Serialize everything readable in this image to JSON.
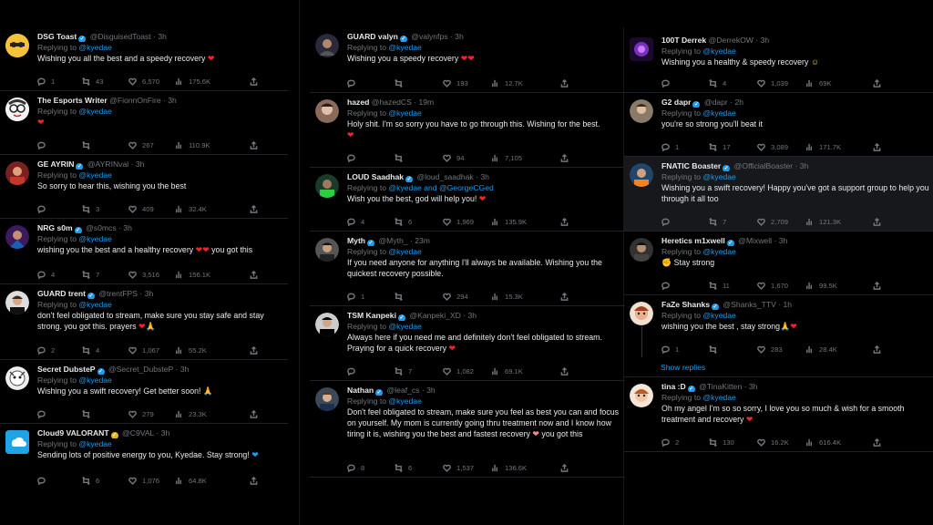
{
  "colors": {
    "background": "#000000",
    "text": "#e7e9ea",
    "muted": "#71767b",
    "link": "#1d9bf0",
    "heart": "#f4212e"
  },
  "columns": [
    {
      "tweets": [
        {
          "name": "DSG Toast",
          "handle": "@DisguisedToast",
          "time": "3h",
          "reply_to": "@kyedae",
          "text": "Wishing you all the best and a speedy recovery",
          "replies": "1",
          "retweets": "43",
          "likes": "6,570",
          "views": "175.6K"
        },
        {
          "name": "The Esports Writer",
          "handle": "@FionnOnFire",
          "time": "3h",
          "reply_to": "@kyedae",
          "text": "",
          "replies": "",
          "retweets": "",
          "likes": "267",
          "views": "110.9K"
        },
        {
          "name": "GE AYRIN",
          "handle": "@AYRINval",
          "time": "3h",
          "reply_to": "@kyedae",
          "text": "So sorry to hear this, wishing you the best",
          "replies": "",
          "retweets": "3",
          "likes": "409",
          "views": "32.4K"
        },
        {
          "name": "NRG s0m",
          "handle": "@s0mcs",
          "time": "3h",
          "reply_to": "@kyedae",
          "text": "wishing you the best and a healthy recovery",
          "text2": "you got this",
          "replies": "4",
          "retweets": "7",
          "likes": "3,516",
          "views": "156.1K"
        },
        {
          "name": "GUARD trent",
          "handle": "@trentFPS",
          "time": "3h",
          "reply_to": "@kyedae",
          "text": "don't feel obligated to stream, make sure you stay safe and stay strong. you got this. prayers",
          "replies": "2",
          "retweets": "4",
          "likes": "1,067",
          "views": "55.2K"
        },
        {
          "name": "Secret DubsteP",
          "handle": "@Secret_DubsteP",
          "time": "3h",
          "reply_to": "@kyedae",
          "text": "Wishing you a swift recovery! Get better soon!",
          "replies": "",
          "retweets": "",
          "likes": "279",
          "views": "23.3K"
        },
        {
          "name": "Cloud9 VALORANT",
          "handle": "@C9VAL",
          "time": "3h",
          "reply_to": "@kyedae",
          "text": "Sending lots of positive energy to you, Kyedae. Stay strong!",
          "replies": "",
          "retweets": "6",
          "likes": "1,076",
          "views": "64.8K"
        }
      ]
    },
    {
      "tweets": [
        {
          "name": "GUARD valyn",
          "handle": "@valynfps",
          "time": "3h",
          "reply_to": "@kyedae",
          "text": "Wishing you a speedy recovery",
          "replies": "",
          "retweets": "",
          "likes": "193",
          "views": "12.7K"
        },
        {
          "name": "hazed",
          "handle": "@hazedCS",
          "time": "19m",
          "reply_to": "@kyedae",
          "text": "Holy shit. I'm so sorry you have to go through this. Wishing for the best.",
          "replies": "",
          "retweets": "",
          "likes": "94",
          "views": "7,105"
        },
        {
          "name": "LOUD Saadhak",
          "handle": "@loud_saadhak",
          "time": "3h",
          "reply_to": "@kyedae and @GeorgeCGed",
          "text": "Wish you the best, god will help you!",
          "replies": "4",
          "retweets": "6",
          "likes": "1,969",
          "views": "135.9K"
        },
        {
          "name": "Myth",
          "handle": "@Myth_",
          "time": "23m",
          "reply_to": "@kyedae",
          "text": "If you need anyone for anything I'll always be available. Wishing you the quickest recovery possible.",
          "replies": "1",
          "retweets": "",
          "likes": "294",
          "views": "15.3K"
        },
        {
          "name": "TSM Kanpeki",
          "handle": "@Kanpeki_XD",
          "time": "3h",
          "reply_to": "@kyedae",
          "text": "Always here if you need me and definitely don't feel obligated to stream. Praying for a quick recovery",
          "replies": "",
          "retweets": "7",
          "likes": "1,082",
          "views": "69.1K"
        },
        {
          "name": "Nathan",
          "handle": "@leaf_cs",
          "time": "3h",
          "reply_to": "@kyedae",
          "text": "Don't feel obligated to stream, make sure you feel as best you can and focus on yourself. My mom is currently going thru treatment now and I know how tiring it is, wishing you the best and fastest recovery",
          "text2": "you got this",
          "replies": "8",
          "retweets": "6",
          "likes": "1,537",
          "views": "136.6K"
        }
      ]
    },
    {
      "tweets": [
        {
          "name": "100T Derrek",
          "handle": "@DerrekOW",
          "time": "3h",
          "reply_to": "@kyedae",
          "text": "Wishing you a healthy & speedy recovery",
          "replies": "",
          "retweets": "4",
          "likes": "1,039",
          "views": "69K"
        },
        {
          "name": "G2 dapr",
          "handle": "@dapr",
          "time": "2h",
          "reply_to": "@kyedae",
          "text": "you're so strong you'll beat it",
          "replies": "1",
          "retweets": "17",
          "likes": "3,089",
          "views": "171.7K"
        },
        {
          "name": "FNATIC Boaster",
          "handle": "@OfficialBoaster",
          "time": "3h",
          "reply_to": "@kyedae",
          "text": "Wishing you a swift recovery! Happy you've got a support group to help you through it all too",
          "replies": "",
          "retweets": "7",
          "likes": "2,709",
          "views": "121.3K"
        },
        {
          "name": "Heretics m1xwell",
          "handle": "@Mixwell",
          "time": "3h",
          "reply_to": "@kyedae",
          "text": "Stay strong",
          "replies": "",
          "retweets": "11",
          "likes": "1,670",
          "views": "99.5K"
        },
        {
          "name": "FaZe Shanks",
          "handle": "@Shanks_TTV",
          "time": "1h",
          "reply_to": "@kyedae",
          "text": "wishing you the best , stay strong",
          "replies": "1",
          "retweets": "",
          "likes": "283",
          "views": "28.4K"
        },
        {
          "name": "tina :D",
          "handle": "@TinaKitten",
          "time": "3h",
          "reply_to": "@kyedae",
          "text": "Oh my angel I'm so so sorry, I love you so much & wish for a smooth treatment and recovery",
          "replies": "2",
          "retweets": "130",
          "likes": "16.2K",
          "views": "616.4K"
        }
      ]
    }
  ],
  "show_replies": "Show replies",
  "replying_label": "Replying to"
}
